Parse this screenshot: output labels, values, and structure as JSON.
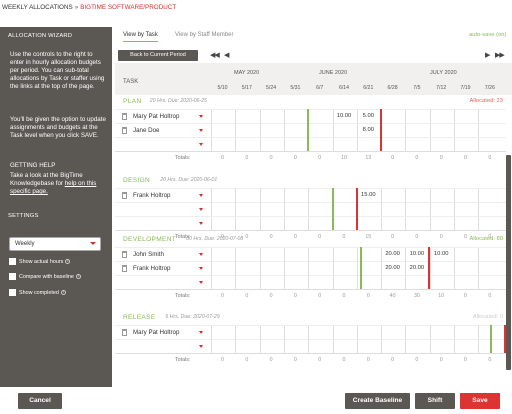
{
  "breadcrumb": {
    "first": "WEEKLY ALLOCATIONS",
    "separator": "»",
    "second": "BIGTIME SOFTWARE/PRODUCT"
  },
  "sidebar": {
    "title": "ALLOCATION WIZARD",
    "p1": "Use the controls to the right to enter in hourly allocation budgets per period. You can sub-total allocations by Task or staffer using the links at the top of the page.",
    "p2": "You'll be given the option to update assignments and budgets at the Task level when you click SAVE.",
    "help_title": "GETTING HELP",
    "help_text": "Take a look at the BigTime Knowledgebase for ",
    "help_link": "help on this specific page.",
    "settings_title": "SETTINGS",
    "period_value": "Weekly",
    "checks": [
      "Show actual hours",
      "Compare with baseline",
      "Show completed"
    ]
  },
  "tabs": [
    "View by Task",
    "View by Staff Member"
  ],
  "autosave": "auto-save (on)",
  "back_label": "Back to Current Period",
  "nav": {
    "prev_all": "◀◀",
    "prev": "◀",
    "next": "▶",
    "next_all": "▶▶"
  },
  "header": {
    "task": "TASK",
    "months": [
      "MAY 2020",
      "JUNE 2020",
      "JULY 2020"
    ],
    "dates": [
      "5/10",
      "5/17",
      "5/24",
      "5/31",
      "6/7",
      "6/14",
      "6/21",
      "6/28",
      "7/5",
      "7/12",
      "7/19",
      "7/26"
    ]
  },
  "sections": [
    {
      "name": "PLAN",
      "extra": "20 Hrs. Due: 2020-06-25",
      "allocated": "Allocated: 23",
      "alloc_color": "#d66",
      "rows": [
        {
          "person": "Mary Pat Holtrop",
          "values": [
            "",
            "",
            "",
            "",
            "",
            "10.00",
            "5.00",
            "",
            "",
            "",
            "",
            ""
          ]
        },
        {
          "person": "Jane Doe",
          "values": [
            "",
            "",
            "",
            "",
            "",
            "",
            "8.00",
            "",
            "",
            "",
            "",
            ""
          ]
        },
        {
          "person": "",
          "values": [
            "",
            "",
            "",
            "",
            "",
            "",
            "",
            "",
            "",
            "",
            "",
            ""
          ]
        }
      ],
      "totals": [
        "0",
        "0",
        "0",
        "0",
        "0",
        "10",
        "13",
        "0",
        "0",
        "0",
        "0",
        "0"
      ]
    },
    {
      "name": "DESIGN",
      "extra": "20 Hrs. Due: 2020-06-01",
      "allocated": "",
      "alloc_color": "#d66",
      "rows": [
        {
          "person": "Frank Holtrop",
          "values": [
            "",
            "",
            "",
            "",
            "",
            "",
            "15.00",
            "",
            "",
            "",
            "",
            ""
          ]
        },
        {
          "person": "",
          "values": [
            "",
            "",
            "",
            "",
            "",
            "",
            "",
            "",
            "",
            "",
            "",
            ""
          ]
        },
        {
          "person": "",
          "values": [
            "",
            "",
            "",
            "",
            "",
            "",
            "",
            "",
            "",
            "",
            "",
            ""
          ]
        }
      ],
      "totals": [
        "0",
        "0",
        "0",
        "0",
        "0",
        "0",
        "15",
        "0",
        "0",
        "0",
        "0",
        "0"
      ]
    },
    {
      "name": "DEVELOPMENT",
      "extra": "80 Hrs. Due: 2020-07-08",
      "allocated": "Allocated: 80",
      "alloc_color": "#8ab95a",
      "rows": [
        {
          "person": "John Smith",
          "values": [
            "",
            "",
            "",
            "",
            "",
            "",
            "",
            "20.00",
            "10.00",
            "10.00",
            "",
            ""
          ]
        },
        {
          "person": "Frank Holtrop",
          "values": [
            "",
            "",
            "",
            "",
            "",
            "",
            "",
            "20.00",
            "20.00",
            "",
            "",
            ""
          ]
        },
        {
          "person": "",
          "values": [
            "",
            "",
            "",
            "",
            "",
            "",
            "",
            "",
            "",
            "",
            "",
            ""
          ]
        }
      ],
      "totals": [
        "0",
        "0",
        "0",
        "0",
        "0",
        "0",
        "0",
        "40",
        "30",
        "10",
        "0",
        "0"
      ]
    },
    {
      "name": "RELEASE",
      "extra": "5 Hrs. Due: 2020-07-29",
      "allocated": "Allocated: 0",
      "alloc_color": "#ccc",
      "rows": [
        {
          "person": "Mary Pat Holtrop",
          "values": [
            "",
            "",
            "",
            "",
            "",
            "",
            "",
            "",
            "",
            "",
            "",
            ""
          ]
        },
        {
          "person": "",
          "values": [
            "",
            "",
            "",
            "",
            "",
            "",
            "",
            "",
            "",
            "",
            "",
            ""
          ]
        }
      ],
      "totals": [
        "0",
        "0",
        "0",
        "0",
        "0",
        "0",
        "0",
        "0",
        "0",
        "0",
        "0",
        "0"
      ]
    }
  ],
  "totals_label": "Totals:",
  "footer": {
    "cancel": "Cancel",
    "create_baseline": "Create Baseline",
    "shift": "Shift",
    "save": "Save"
  },
  "colors": {
    "accent_green": "#8ab95a",
    "accent_red": "#d33",
    "sidebar": "#5b5853"
  }
}
